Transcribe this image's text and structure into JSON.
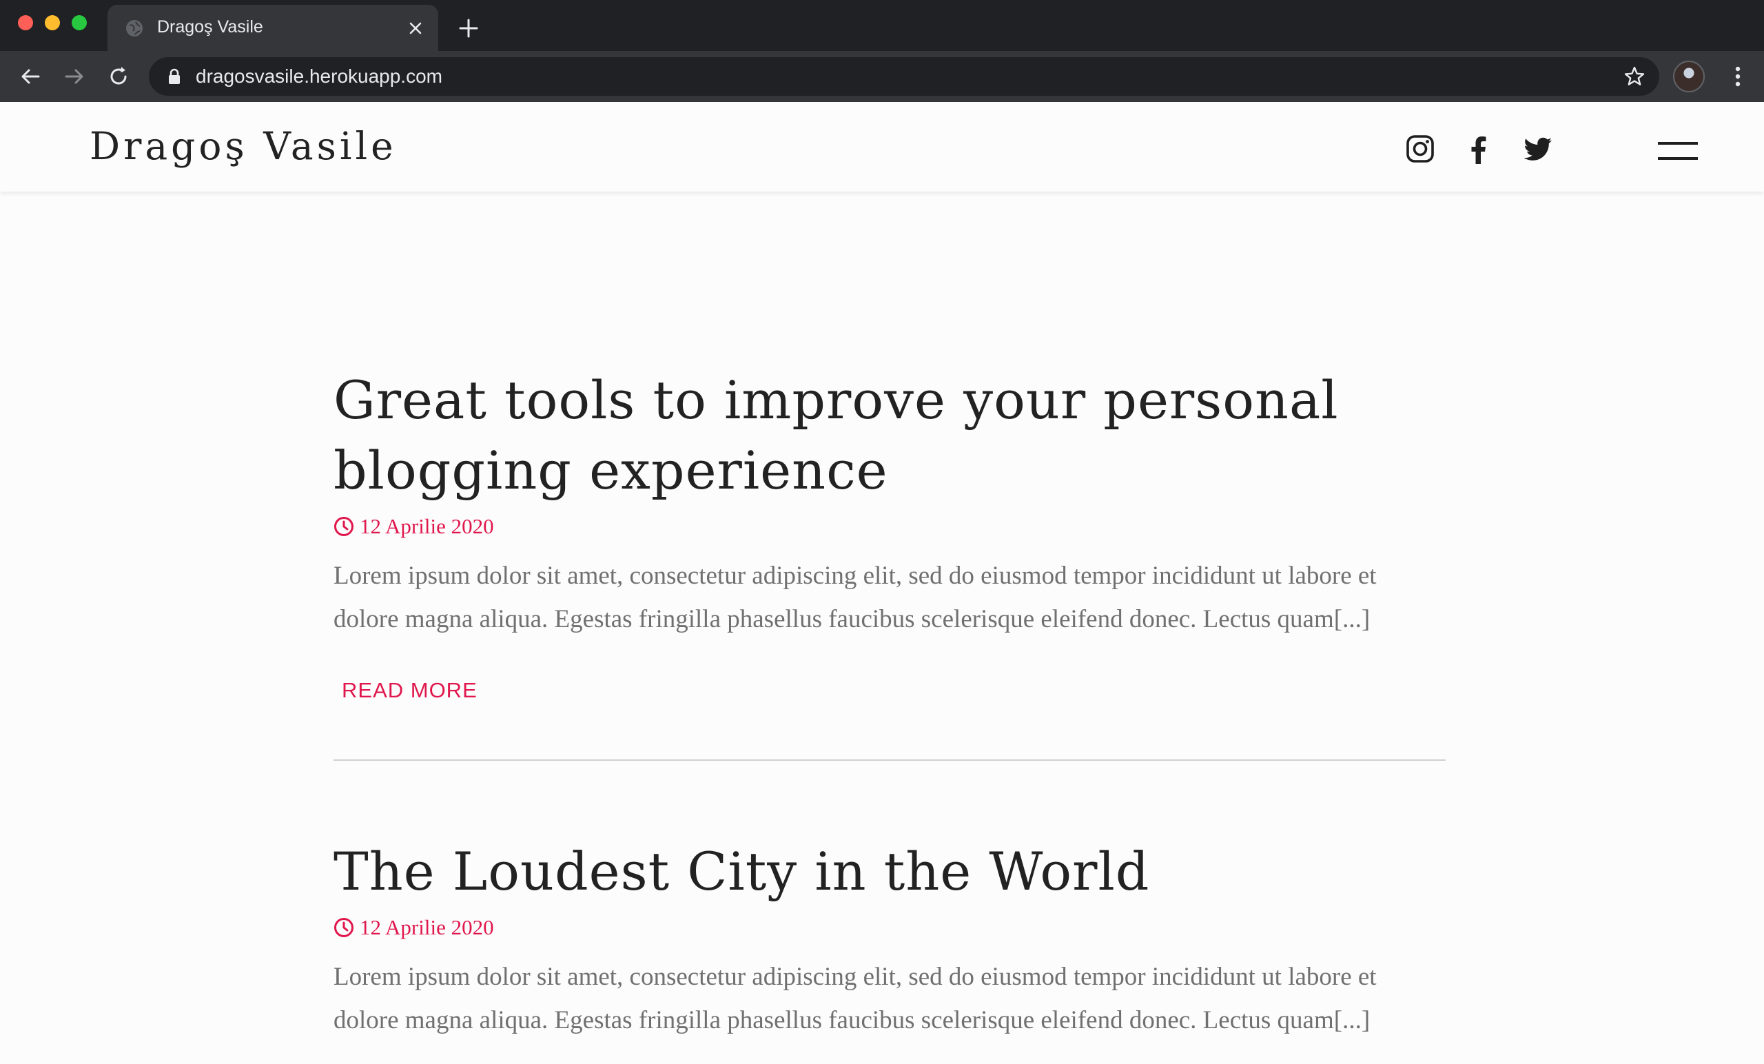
{
  "browser": {
    "tab_title": "Dragoş Vasile",
    "url": "dragosvasile.herokuapp.com"
  },
  "site": {
    "brand": "Dragoş Vasile",
    "social_icons": [
      "instagram-icon",
      "facebook-icon",
      "twitter-icon"
    ]
  },
  "posts": [
    {
      "title": "Great tools to improve your personal blogging experience",
      "date": "12 Aprilie 2020",
      "excerpt": "Lorem ipsum dolor sit amet, consectetur adipiscing elit, sed do eiusmod tempor incididunt ut labore et dolore magna aliqua. Egestas fringilla phasellus faucibus scelerisque eleifend donec. Lectus quam[...]",
      "read_more": "READ MORE"
    },
    {
      "title": "The Loudest City in the World",
      "date": "12 Aprilie 2020",
      "excerpt": "Lorem ipsum dolor sit amet, consectetur adipiscing elit, sed do eiusmod tempor incididunt ut labore et dolore magna aliqua. Egestas fringilla phasellus faucibus scelerisque eleifend donec. Lectus quam[...]"
    }
  ],
  "colors": {
    "accent": "#e0174d",
    "text": "#222222",
    "muted": "#707070",
    "chrome_dark": "#202124"
  }
}
